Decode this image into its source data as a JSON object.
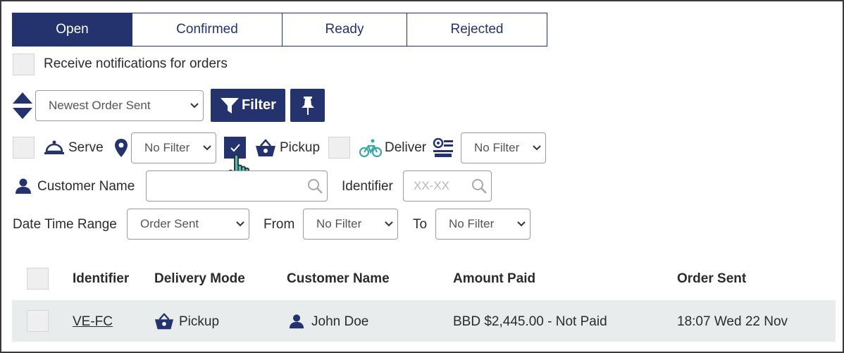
{
  "tabs": [
    {
      "label": "Open",
      "active": true
    },
    {
      "label": "Confirmed",
      "active": false
    },
    {
      "label": "Ready",
      "active": false
    },
    {
      "label": "Rejected",
      "active": false
    }
  ],
  "notifications": {
    "label": "Receive notifications for orders",
    "checked": false
  },
  "sort": {
    "selected": "Newest Order Sent"
  },
  "filter_button": {
    "label": "Filter"
  },
  "delivery_filters": {
    "serve": {
      "label": "Serve",
      "checked": false
    },
    "location_select": "No Filter",
    "pickup": {
      "label": "Pickup",
      "checked": true
    },
    "deliver": {
      "label": "Deliver",
      "checked": false
    },
    "deliver_select": "No Filter"
  },
  "customer": {
    "label": "Customer Name",
    "placeholder": ""
  },
  "identifier": {
    "label": "Identifier",
    "placeholder": "XX-XX"
  },
  "date_range": {
    "label": "Date Time Range",
    "selected": "Order Sent",
    "from_label": "From",
    "from_selected": "No Filter",
    "to_label": "To",
    "to_selected": "No Filter"
  },
  "table": {
    "headers": [
      "Identifier",
      "Delivery Mode",
      "Customer Name",
      "Amount Paid",
      "Order Sent"
    ],
    "rows": [
      {
        "identifier": "VE-FC",
        "delivery_mode": "Pickup",
        "customer_name": "John Doe",
        "amount_paid": "BBD $2,445.00 - Not Paid",
        "order_sent": "18:07 Wed 22 Nov"
      }
    ]
  },
  "colors": {
    "primary": "#24336e",
    "accent_teal": "#3aa6a6",
    "row_bg": "#e8eced"
  }
}
